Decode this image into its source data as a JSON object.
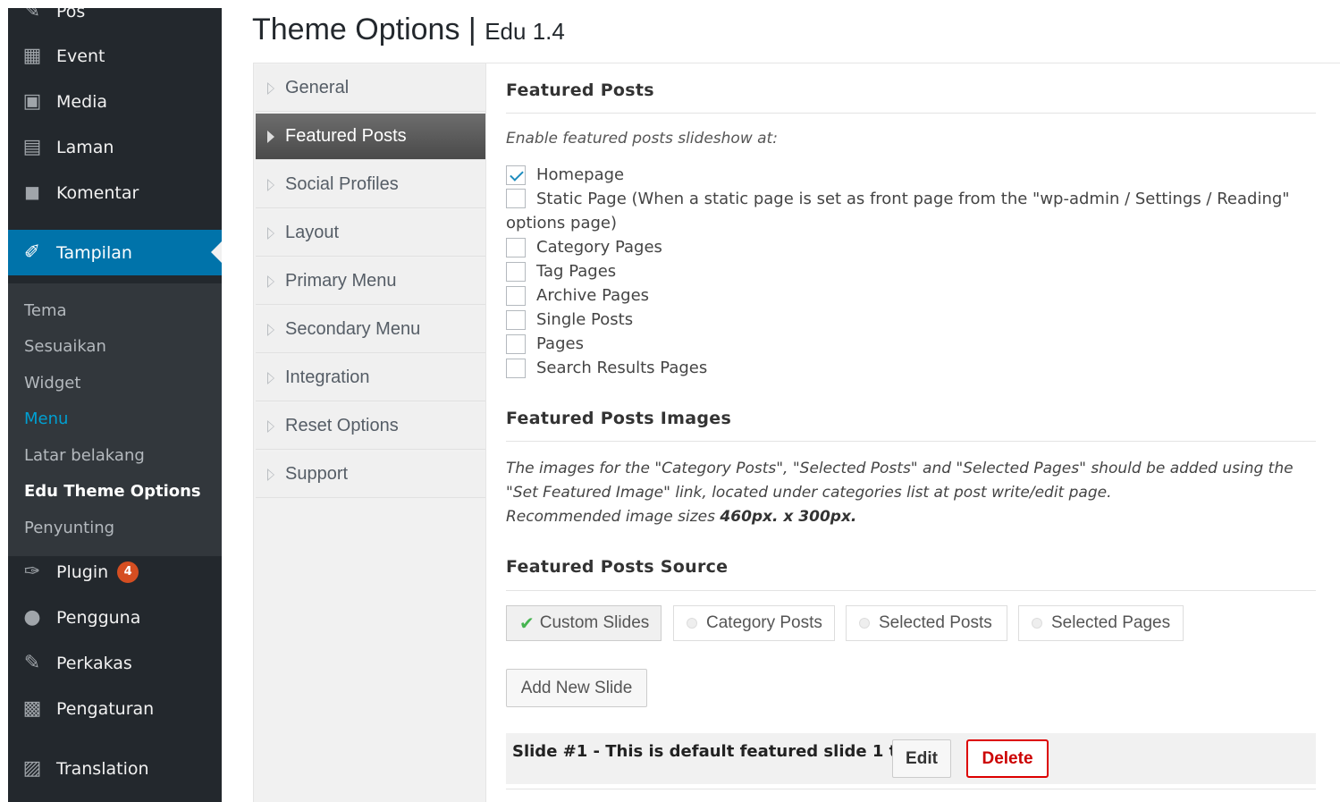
{
  "sidebar": {
    "items": [
      {
        "label": "Pos",
        "icon": "pin-icon"
      },
      {
        "label": "Event",
        "icon": "calendar-icon"
      },
      {
        "label": "Media",
        "icon": "media-icon"
      },
      {
        "label": "Laman",
        "icon": "page-icon"
      },
      {
        "label": "Komentar",
        "icon": "comment-icon"
      },
      {
        "label": "Tampilan",
        "icon": "brush-icon"
      },
      {
        "label": "Plugin",
        "icon": "plugin-icon",
        "badge": "4"
      },
      {
        "label": "Pengguna",
        "icon": "user-icon"
      },
      {
        "label": "Perkakas",
        "icon": "wrench-icon"
      },
      {
        "label": "Pengaturan",
        "icon": "settings-icon"
      },
      {
        "label": "Translation",
        "icon": "translation-icon"
      }
    ],
    "submenu": [
      "Tema",
      "Sesuaikan",
      "Widget",
      "Menu",
      "Latar belakang",
      "Edu Theme Options",
      "Penyunting"
    ]
  },
  "page": {
    "title": "Theme Options",
    "separator": "|",
    "version": "Edu 1.4"
  },
  "tabs": [
    "General",
    "Featured Posts",
    "Social Profiles",
    "Layout",
    "Primary Menu",
    "Secondary Menu",
    "Integration",
    "Reset Options",
    "Support"
  ],
  "featured": {
    "heading": "Featured Posts",
    "enable_label": "Enable featured posts slideshow at:",
    "options": [
      {
        "label": "Homepage",
        "checked": true
      },
      {
        "label": "Static Page (When a static page is set as front page from the \"wp-admin / Settings / Reading\" options page)",
        "checked": false
      },
      {
        "label": "Category Pages",
        "checked": false
      },
      {
        "label": "Tag Pages",
        "checked": false
      },
      {
        "label": "Archive Pages",
        "checked": false
      },
      {
        "label": "Single Posts",
        "checked": false
      },
      {
        "label": "Pages",
        "checked": false
      },
      {
        "label": "Search Results Pages",
        "checked": false
      }
    ]
  },
  "images": {
    "heading": "Featured Posts Images",
    "desc1": "The images for the \"Category Posts\", \"Selected Posts\" and \"Selected Pages\" should be added using the \"Set Featured Image\" link, located under categories list at post write/edit page.",
    "desc2_prefix": "Recommended image sizes ",
    "desc2_value": "460px. x 300px."
  },
  "source": {
    "heading": "Featured Posts Source",
    "options": [
      {
        "label": "Custom Slides",
        "selected": true
      },
      {
        "label": "Category Posts",
        "selected": false
      },
      {
        "label": "Selected Posts",
        "selected": false
      },
      {
        "label": "Selected Pages",
        "selected": false
      }
    ],
    "add_button": "Add New Slide"
  },
  "slide": {
    "title": "Slide #1 - This is default featured slide 1 title",
    "edit": "Edit",
    "delete": "Delete"
  }
}
